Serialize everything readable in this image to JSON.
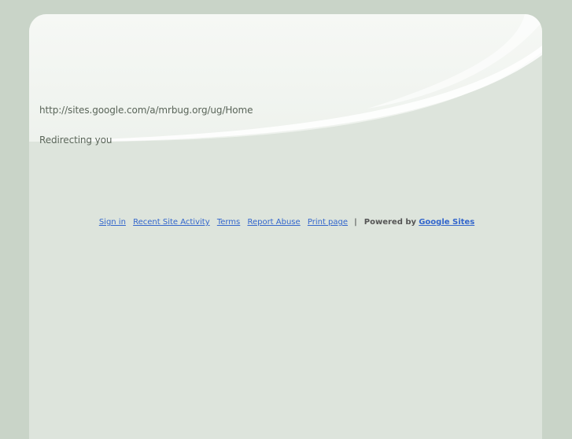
{
  "content": {
    "url": "http://sites.google.com/a/mrbug.org/ug/Home",
    "status": "Redirecting you"
  },
  "footer": {
    "links": [
      "Sign in",
      "Recent Site Activity",
      "Terms",
      "Report Abuse",
      "Print page"
    ],
    "separator": "|",
    "powered_by": "Powered by",
    "brand_link": "Google Sites"
  },
  "colors": {
    "background": "#c9d4c8",
    "panel": "#dde4dc",
    "link": "#3366cc",
    "text": "#5a6559"
  }
}
